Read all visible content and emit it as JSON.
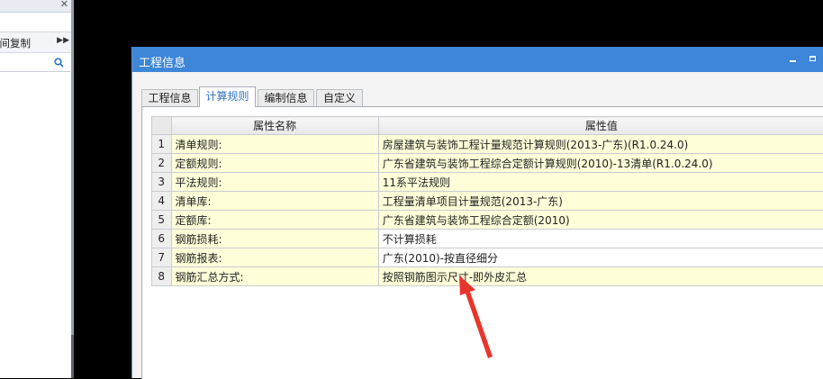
{
  "left_panel": {
    "toolbar_label": "层间复制",
    "more_icon": "double-chevron-right-icon",
    "search_icon": "search-icon",
    "close_icon": "close-icon"
  },
  "dialog": {
    "title": "工程信息",
    "tabs": [
      {
        "label": "工程信息",
        "active": false
      },
      {
        "label": "计算规则",
        "active": true
      },
      {
        "label": "编制信息",
        "active": false
      },
      {
        "label": "自定义",
        "active": false
      }
    ],
    "grid": {
      "columns": [
        "属性名称",
        "属性值"
      ],
      "rows": [
        {
          "index": "1",
          "name": "清单规则:",
          "value": "房屋建筑与装饰工程计量规范计算规则(2013-广东)(R1.0.24.0)"
        },
        {
          "index": "2",
          "name": "定额规则:",
          "value": "广东省建筑与装饰工程综合定额计算规则(2010)-13清单(R1.0.24.0)"
        },
        {
          "index": "3",
          "name": "平法规则:",
          "value": "11系平法规则"
        },
        {
          "index": "4",
          "name": "清单库:",
          "value": "工程量清单项目计量规范(2013-广东)"
        },
        {
          "index": "5",
          "name": "定额库:",
          "value": "广东省建筑与装饰工程综合定额(2010)"
        },
        {
          "index": "6",
          "name": "钢筋损耗:",
          "value": "不计算损耗"
        },
        {
          "index": "7",
          "name": "钢筋报表:",
          "value": "广东(2010)-按直径细分"
        },
        {
          "index": "8",
          "name": "钢筋汇总方式:",
          "value": "按照钢筋图示尺寸-即外皮汇总"
        }
      ]
    }
  },
  "colors": {
    "titlebar": "#3d86d8",
    "active_tab_text": "#2f73c8",
    "editable_cell": "#ffffd9",
    "annotation_arrow": "#e8352a"
  }
}
